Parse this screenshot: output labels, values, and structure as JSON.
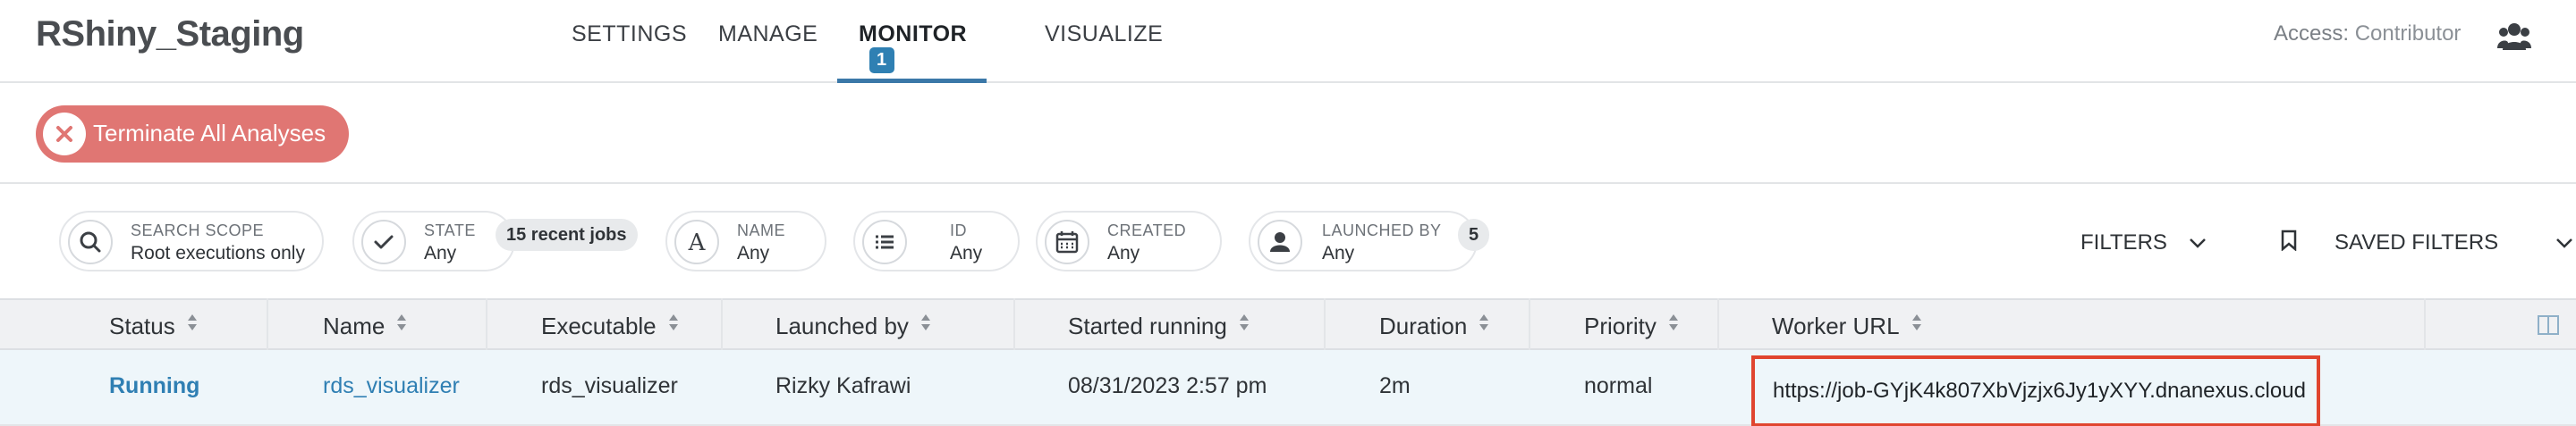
{
  "app": {
    "title": "RShiny_Staging"
  },
  "nav": {
    "tabs": [
      {
        "label": "SETTINGS"
      },
      {
        "label": "MANAGE"
      },
      {
        "label": "MONITOR",
        "badge": "1",
        "active": true
      },
      {
        "label": "VISUALIZE"
      }
    ]
  },
  "access": {
    "label": "Access:",
    "role": "Contributor"
  },
  "actions": {
    "terminate_label": "Terminate All Analyses"
  },
  "filters": {
    "search_scope": {
      "title": "SEARCH SCOPE",
      "value": "Root executions only"
    },
    "state": {
      "title": "STATE",
      "value": "Any",
      "count": "15 recent jobs"
    },
    "name": {
      "title": "NAME",
      "value": "Any"
    },
    "id": {
      "title": "ID",
      "value": "Any"
    },
    "created": {
      "title": "CREATED",
      "value": "Any"
    },
    "launched_by": {
      "title": "LAUNCHED BY",
      "value": "Any",
      "count": "5"
    },
    "filters_label": "FILTERS",
    "saved_filters_label": "SAVED FILTERS"
  },
  "table": {
    "columns": [
      "Status",
      "Name",
      "Executable",
      "Launched by",
      "Started running",
      "Duration",
      "Priority",
      "Worker URL"
    ],
    "rows": [
      {
        "status": "Running",
        "name": "rds_visualizer",
        "executable": "rds_visualizer",
        "launched_by": "Rizky Kafrawi",
        "started": "08/31/2023 2:57 pm",
        "duration": "2m",
        "priority": "normal",
        "worker_url": "https://job-GYjK4k807XbVjzjx6Jy1yXYY.dnanexus.cloud"
      }
    ]
  },
  "colors": {
    "accent": "#2f80b3",
    "terminate": "#e07673",
    "highlight_box": "#e0452f",
    "row_bg": "#eef6fa"
  },
  "icons": [
    "users-icon",
    "close-icon",
    "search-icon",
    "check-icon",
    "letter-a-icon",
    "list-icon",
    "calendar-icon",
    "person-icon",
    "chevron-down-icon",
    "bookmark-icon",
    "sort-icon",
    "columns-icon"
  ]
}
